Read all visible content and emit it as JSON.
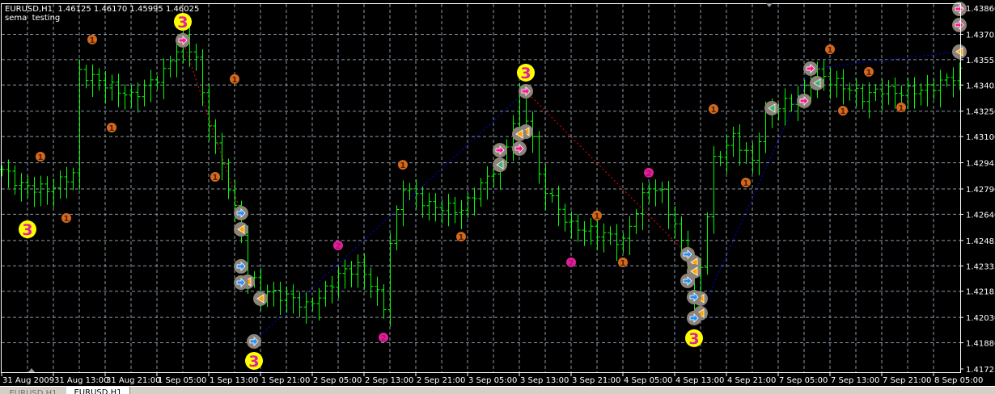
{
  "header": {
    "symbol_line": "EURUSD,H1  1.46125 1.46170 1.45995 1.46025",
    "indicator_line": "sema  testing"
  },
  "tabs": [
    {
      "label": "EURUSD,H1",
      "active": false
    },
    {
      "label": "EURUSD,H1",
      "active": true
    }
  ],
  "colors": {
    "background": "#000000",
    "bars": "#00ff00",
    "grid": "#8a98a8",
    "axis_text": "#ffffff",
    "sema1": "#d2691e",
    "sema2": "#e0209a",
    "sema3": "#ffff00",
    "marker_bg": "#8c8478",
    "buy_arrow": "#1e90ff",
    "sell_arrow": "#ff1493",
    "exit_arrow": "#ffa500",
    "zigzag_up": "#0000ff",
    "zigzag_down": "#ff0000"
  },
  "chart_data": {
    "type": "ohlc-bar",
    "symbol": "EURUSD",
    "timeframe": "H1",
    "grid": true,
    "price_axis": {
      "position": "right",
      "ticks": [
        "1.43860",
        "1.43705",
        "1.43555",
        "1.43405",
        "1.43250",
        "1.43100",
        "1.42945",
        "1.42790",
        "1.42640",
        "1.42485",
        "1.42335",
        "1.42185",
        "1.42030",
        "1.41880",
        "1.41725"
      ]
    },
    "time_axis": {
      "labels": [
        {
          "text": "31 Aug 2009",
          "time": "31 Aug 05:00"
        },
        {
          "text": "31 Aug 13:00",
          "time": "31 Aug 13:00"
        },
        {
          "text": "31 Aug 21:00",
          "time": "31 Aug 21:00"
        },
        {
          "text": "1 Sep 05:00",
          "time": "1 Sep 05:00"
        },
        {
          "text": "1 Sep 13:00",
          "time": "1 Sep 13:00"
        },
        {
          "text": "1 Sep 21:00",
          "time": "1 Sep 21:00"
        },
        {
          "text": "2 Sep 05:00",
          "time": "2 Sep 05:00"
        },
        {
          "text": "2 Sep 13:00",
          "time": "2 Sep 13:00"
        },
        {
          "text": "2 Sep 21:00",
          "time": "2 Sep 21:00"
        },
        {
          "text": "3 Sep 05:00",
          "time": "3 Sep 05:00"
        },
        {
          "text": "3 Sep 13:00",
          "time": "3 Sep 13:00"
        },
        {
          "text": "3 Sep 21:00",
          "time": "3 Sep 21:00"
        },
        {
          "text": "4 Sep 05:00",
          "time": "4 Sep 05:00"
        },
        {
          "text": "4 Sep 13:00",
          "time": "4 Sep 13:00"
        },
        {
          "text": "4 Sep 21:00",
          "time": "4 Sep 21:00"
        },
        {
          "text": "7 Sep 05:00",
          "time": "7 Sep 05:00"
        },
        {
          "text": "7 Sep 13:00",
          "time": "7 Sep 13:00"
        },
        {
          "text": "7 Sep 21:00",
          "time": "7 Sep 21:00"
        },
        {
          "text": "8 Sep 05:00",
          "time": "8 Sep 05:00"
        }
      ]
    },
    "close_samples": [
      [
        "31 Aug 05:00",
        1.42905
      ],
      [
        "31 Aug 08:00",
        1.42809
      ],
      [
        "31 Aug 12:00",
        1.42785
      ],
      [
        "31 Aug 16:00",
        1.42881
      ],
      [
        "31 Aug 17:00",
        1.43478
      ],
      [
        "31 Aug 20:00",
        1.4343
      ],
      [
        "1 Sep 01:00",
        1.43335
      ],
      [
        "1 Sep 06:00",
        1.43478
      ],
      [
        "1 Sep 08:00",
        1.43621
      ],
      [
        "1 Sep 09:00",
        1.43669
      ],
      [
        "1 Sep 11:00",
        1.43573
      ],
      [
        "1 Sep 12:00",
        1.43335
      ],
      [
        "1 Sep 14:00",
        1.43048
      ],
      [
        "1 Sep 16:00",
        1.42809
      ],
      [
        "1 Sep 18:00",
        1.42523
      ],
      [
        "1 Sep 19:00",
        1.42284
      ],
      [
        "1 Sep 21:00",
        1.42188
      ],
      [
        "2 Sep 02:00",
        1.42141
      ],
      [
        "2 Sep 04:00",
        1.42093
      ],
      [
        "2 Sep 07:00",
        1.42188
      ],
      [
        "2 Sep 09:00",
        1.42284
      ],
      [
        "2 Sep 12:00",
        1.42332
      ],
      [
        "2 Sep 14:00",
        1.42236
      ],
      [
        "2 Sep 16:00",
        1.42093
      ],
      [
        "2 Sep 17:00",
        1.42475
      ],
      [
        "2 Sep 19:00",
        1.42809
      ],
      [
        "2 Sep 23:00",
        1.4269
      ],
      [
        "3 Sep 04:00",
        1.42666
      ],
      [
        "3 Sep 06:00",
        1.42762
      ],
      [
        "3 Sep 09:00",
        1.42905
      ],
      [
        "3 Sep 11:00",
        1.43048
      ],
      [
        "3 Sep 13:00",
        1.43335
      ],
      [
        "3 Sep 15:00",
        1.43096
      ],
      [
        "3 Sep 16:00",
        1.42857
      ],
      [
        "3 Sep 19:00",
        1.42666
      ],
      [
        "3 Sep 21:00",
        1.4257
      ],
      [
        "4 Sep 02:00",
        1.42523
      ],
      [
        "4 Sep 05:00",
        1.42475
      ],
      [
        "4 Sep 07:00",
        1.42666
      ],
      [
        "4 Sep 09:00",
        1.42809
      ],
      [
        "4 Sep 11:00",
        1.42762
      ],
      [
        "4 Sep 14:00",
        1.42475
      ],
      [
        "4 Sep 15:00",
        1.42332
      ],
      [
        "4 Sep 16:00",
        1.42093
      ],
      [
        "4 Sep 17:00",
        1.42332
      ],
      [
        "4 Sep 19:00",
        1.42953
      ],
      [
        "4 Sep 20:00",
        1.43
      ],
      [
        "4 Sep 22:00",
        1.43096
      ],
      [
        "7 Sep 01:00",
        1.42953
      ],
      [
        "7 Sep 03:00",
        1.43239
      ],
      [
        "7 Sep 08:00",
        1.43335
      ],
      [
        "7 Sep 11:00",
        1.43478
      ],
      [
        "7 Sep 13:00",
        1.4343
      ],
      [
        "7 Sep 16:00",
        1.43382
      ],
      [
        "7 Sep 18:00",
        1.43335
      ],
      [
        "7 Sep 21:00",
        1.43382
      ],
      [
        "7 Sep 23:00",
        1.43359
      ],
      [
        "8 Sep 04:00",
        1.43382
      ],
      [
        "8 Sep 09:00",
        1.43478
      ]
    ],
    "markers": [
      {
        "type": "sema3",
        "label": "3",
        "time": "31 Aug 09:00",
        "price": 1.42551
      },
      {
        "type": "sema3",
        "label": "3",
        "time": "1 Sep 09:00",
        "price": 1.43779
      },
      {
        "type": "sema3",
        "label": "3",
        "time": "3 Sep 14:00",
        "price": 1.43478
      },
      {
        "type": "sema3",
        "label": "3",
        "time": "1 Sep 20:00",
        "price": 1.41773
      },
      {
        "type": "sema3",
        "label": "3",
        "time": "4 Sep 16:00",
        "price": 1.41907
      },
      {
        "type": "sema1",
        "label": "1",
        "time": "31 Aug 19:00",
        "price": 1.43674
      },
      {
        "type": "sema1",
        "label": "1",
        "time": "31 Aug 11:00",
        "price": 1.42981
      },
      {
        "type": "sema1",
        "label": "1",
        "time": "31 Aug 15:00",
        "price": 1.42618
      },
      {
        "type": "sema1",
        "label": "1",
        "time": "31 Aug 22:00",
        "price": 1.43153
      },
      {
        "type": "sema1",
        "label": "1",
        "time": "1 Sep 17:00",
        "price": 1.4344
      },
      {
        "type": "sema1",
        "label": "1",
        "time": "1 Sep 14:00",
        "price": 1.42862
      },
      {
        "type": "sema1",
        "label": "1",
        "time": "2 Sep 19:00",
        "price": 1.42933
      },
      {
        "type": "sema1",
        "label": "1",
        "time": "3 Sep 04:00",
        "price": 1.42508
      },
      {
        "type": "sema1",
        "label": "1",
        "time": "4 Sep 01:00",
        "price": 1.42633
      },
      {
        "type": "sema1",
        "label": "1",
        "time": "4 Sep 05:00",
        "price": 1.42356
      },
      {
        "type": "sema1",
        "label": "1",
        "time": "4 Sep 19:00",
        "price": 1.43263
      },
      {
        "type": "sema1",
        "label": "1",
        "time": "7 Sep 00:00",
        "price": 1.42828
      },
      {
        "type": "sema1",
        "label": "1",
        "time": "7 Sep 13:00",
        "price": 1.43616
      },
      {
        "type": "sema1",
        "label": "1",
        "time": "7 Sep 15:00",
        "price": 1.43253
      },
      {
        "type": "sema1",
        "label": "1",
        "time": "7 Sep 19:00",
        "price": 1.43483
      },
      {
        "type": "sema1",
        "label": "1",
        "time": "8 Sep 00:00",
        "price": 1.43273
      },
      {
        "type": "sema2",
        "label": "2",
        "time": "2 Sep 09:00",
        "price": 1.42456
      },
      {
        "type": "sema2",
        "label": "2",
        "time": "2 Sep 16:00",
        "price": 1.41911
      },
      {
        "type": "sema2",
        "label": "2",
        "time": "3 Sep 21:00",
        "price": 1.42356
      },
      {
        "type": "sema2",
        "label": "2",
        "time": "4 Sep 09:00",
        "price": 1.42886
      },
      {
        "type": "sell",
        "time": "1 Sep 09:00",
        "price": 1.43669
      },
      {
        "type": "sell",
        "time": "3 Sep 14:00",
        "price": 1.43368
      },
      {
        "type": "sell",
        "time": "3 Sep 10:00",
        "price": 1.43019
      },
      {
        "type": "sell",
        "time": "3 Sep 13:00",
        "price": 1.43029
      },
      {
        "type": "sell",
        "time": "7 Sep 09:00",
        "price": 1.43311
      },
      {
        "type": "sell",
        "time": "7 Sep 10:00",
        "price": 1.43502
      },
      {
        "type": "sell",
        "time": "8 Sep 09:00",
        "price": 1.4376
      },
      {
        "type": "sell",
        "time": "8 Sep 09:00",
        "price": 1.43855
      },
      {
        "type": "exit",
        "time": "1 Sep 18:00",
        "price": 1.42551
      },
      {
        "type": "exit",
        "time": "1 Sep 19:00",
        "price": 1.42241
      },
      {
        "type": "exit",
        "time": "1 Sep 21:00",
        "price": 1.42141
      },
      {
        "type": "exit",
        "time": "3 Sep 14:00",
        "price": 1.43129
      },
      {
        "type": "exit",
        "time": "3 Sep 13:00",
        "price": 1.43115
      },
      {
        "type": "exit",
        "time": "4 Sep 16:00",
        "price": 1.42356
      },
      {
        "type": "exit",
        "time": "4 Sep 16:00",
        "price": 1.42303
      },
      {
        "type": "exit",
        "time": "4 Sep 17:00",
        "price": 1.42141
      },
      {
        "type": "exit",
        "time": "4 Sep 17:00",
        "price": 1.42055
      },
      {
        "type": "exit",
        "time": "8 Sep 09:00",
        "price": 1.43602
      },
      {
        "type": "exit-green",
        "time": "7 Sep 11:00",
        "price": 1.43416
      },
      {
        "type": "exit-green",
        "time": "7 Sep 04:00",
        "price": 1.43268
      },
      {
        "type": "exit-green",
        "time": "3 Sep 10:00",
        "price": 1.42933
      },
      {
        "type": "buy",
        "time": "1 Sep 18:00",
        "price": 1.42647
      },
      {
        "type": "buy",
        "time": "1 Sep 18:00",
        "price": 1.42332
      },
      {
        "type": "buy",
        "time": "1 Sep 18:00",
        "price": 1.42236
      },
      {
        "type": "buy",
        "time": "1 Sep 20:00",
        "price": 1.41888
      },
      {
        "type": "buy",
        "time": "4 Sep 15:00",
        "price": 1.42403
      },
      {
        "type": "buy",
        "time": "4 Sep 15:00",
        "price": 1.42246
      },
      {
        "type": "buy",
        "time": "4 Sep 16:00",
        "price": 1.4215
      },
      {
        "type": "buy",
        "time": "4 Sep 16:00",
        "price": 1.42026
      }
    ],
    "zigzag": [
      {
        "direction": "down",
        "from": [
          "1 Sep 09:00",
          1.43669
        ],
        "to": [
          "1 Sep 18:00",
          1.42647
        ]
      },
      {
        "direction": "up",
        "from": [
          "1 Sep 20:00",
          1.41888
        ],
        "to": [
          "3 Sep 14:00",
          1.43368
        ]
      },
      {
        "direction": "down",
        "from": [
          "3 Sep 14:00",
          1.43368
        ],
        "to": [
          "4 Sep 15:00",
          1.42403
        ]
      },
      {
        "direction": "up",
        "from": [
          "4 Sep 17:00",
          1.42055
        ],
        "to": [
          "7 Sep 10:00",
          1.43502
        ]
      },
      {
        "direction": "up",
        "from": [
          "7 Sep 10:00",
          1.43502
        ],
        "to": [
          "8 Sep 09:00",
          1.43602
        ]
      }
    ]
  }
}
